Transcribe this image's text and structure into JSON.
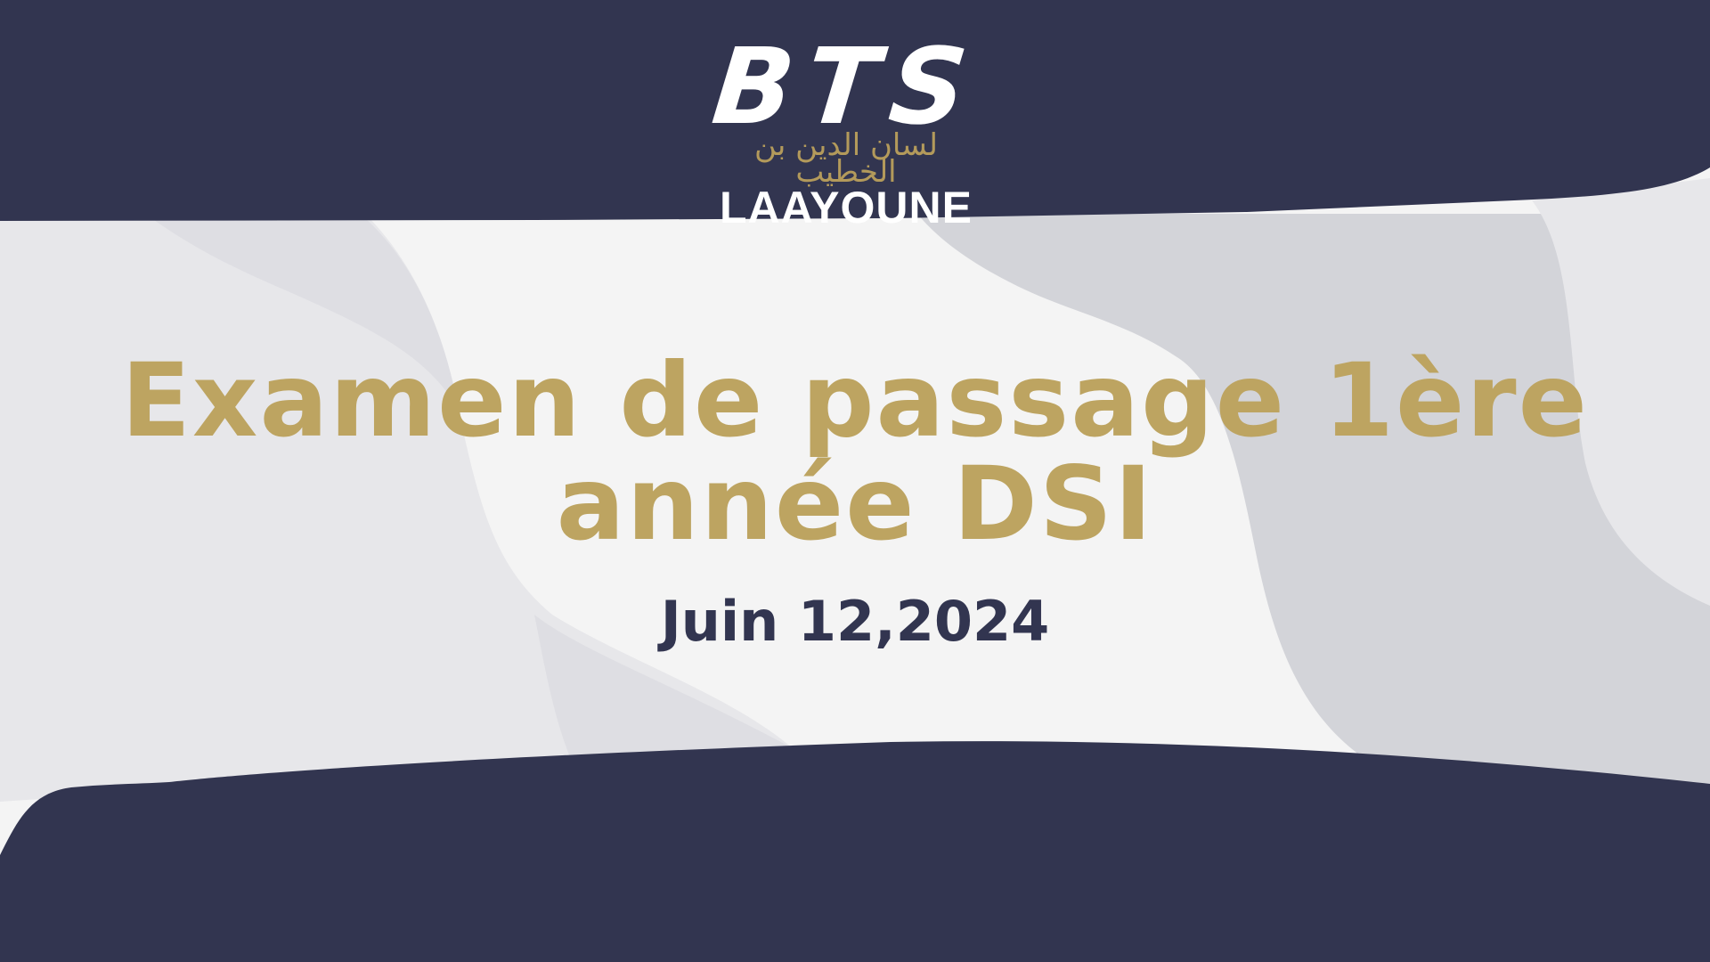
{
  "logo": {
    "brand": "BTS",
    "arabic": "لسان الدين بن الخطيب",
    "city": "LAAYOUNE"
  },
  "title": {
    "line1": "Examen de passage 1ère",
    "line2": "année DSI"
  },
  "date": "Juin 12,2024",
  "colors": {
    "navy": "#323550",
    "gold": "#bda461",
    "background": "#f4f4f4"
  }
}
